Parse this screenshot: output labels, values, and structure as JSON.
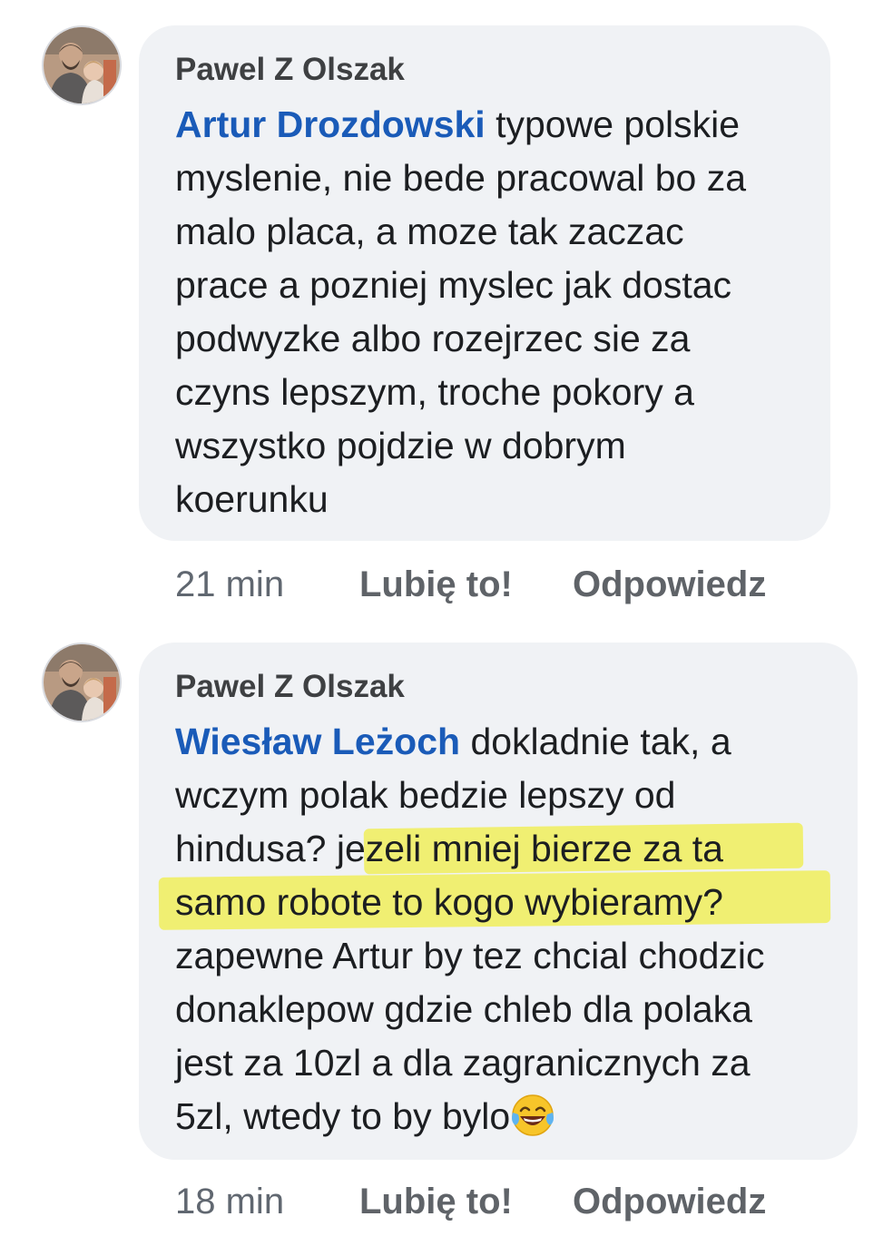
{
  "comments": [
    {
      "author": "Pawel Z Olszak",
      "mention": "Artur Drozdowski",
      "lines": [
        " typowe polskie",
        "myslenie, nie bede pracowal bo za",
        "malo placa, a moze tak zaczac",
        "prace a pozniej myslec jak dostac",
        "podwyzke albo rozejrzec sie za",
        "czyns lepszym, troche pokory a",
        "wszystko pojdzie w dobrym",
        "koerunku"
      ],
      "time": "21 min",
      "like_label": "Lubię to!",
      "reply_label": "Odpowiedz"
    },
    {
      "author": "Pawel Z Olszak",
      "mention": "Wiesław Leżoch",
      "lines": [
        " dokladnie tak, a",
        "wczym polak bedzie lepszy od",
        "hindusa? j",
        "ezeli mniej bierze za ta",
        "samo robote to kogo wybieramy?",
        "zapewne Artur by tez chcial chodzic",
        "donaklepow gdzie chleb dla polaka",
        "jest za 10zl a dla zagranicznych za",
        "5zl, wtedy to by bylo"
      ],
      "emoji": "face-with-tears-of-joy-emoji",
      "highlight_color": "#f0ee46",
      "time": "18 min",
      "like_label": "Lubię to!",
      "reply_label": "Odpowiedz"
    }
  ],
  "colors": {
    "bubble": "#f0f2f5",
    "mention": "#1a5bb8",
    "author": "#3e4042",
    "text": "#1c1e21",
    "meta": "#5f6368"
  }
}
